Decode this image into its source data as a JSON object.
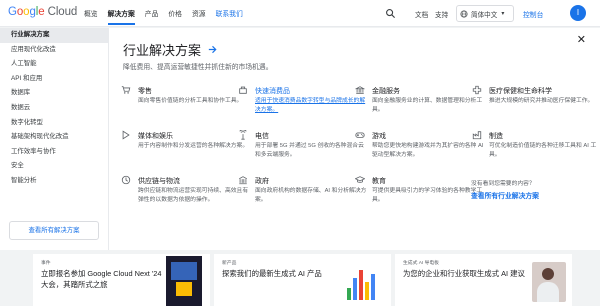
{
  "header": {
    "logo": {
      "g": "G",
      "o1": "o",
      "o2": "o",
      "g2": "g",
      "l": "l",
      "e": "e",
      "cloud": "Cloud"
    },
    "nav": [
      "概览",
      "解决方案",
      "产品",
      "价格",
      "资源",
      "联系我们"
    ],
    "active_nav": "解决方案",
    "docs": "文档",
    "support": "支持",
    "language": "简体中文",
    "console": "控制台",
    "avatar_letter": "I"
  },
  "sidebar": {
    "items": [
      "行业解决方案",
      "应用现代化改造",
      "人工智能",
      "API 和应用",
      "数据库",
      "数据云",
      "数字化转型",
      "基础架构现代化改造",
      "工作效率与协作",
      "安全",
      "智能分析"
    ],
    "active_index": 0,
    "view_all": "查看所有解决方案"
  },
  "panel": {
    "title": "行业解决方案",
    "description": "降低费用、提高运营敏捷性并抓住新的市场机遇。",
    "close_icon": "close-icon",
    "cards": [
      {
        "icon": "cart-icon",
        "title": "零售",
        "desc": "面向零售价值链的分析工具和协作工具。"
      },
      {
        "icon": "cpg-icon",
        "title": "快速消费品",
        "desc": "适用于快速消费品数字转型与品牌成长的解决方案。",
        "highlighted": true
      },
      {
        "icon": "bank-icon",
        "title": "金融服务",
        "desc": "面向金融服务业的计算、数据管理和分析工具。"
      },
      {
        "icon": "health-icon",
        "title": "医疗保健和生命科学",
        "desc": "推进大规模的研究并推动医疗保健工作。"
      },
      {
        "icon": "media-icon",
        "title": "媒体和娱乐",
        "desc": "用于内容制作和分发运营的各种解决方案。"
      },
      {
        "icon": "telecom-icon",
        "title": "电信",
        "desc": "用于部署 5G 并通过 5G 创收的各种混合云和多云端服务。"
      },
      {
        "icon": "game-icon",
        "title": "游戏",
        "desc": "帮助您更快地构建游戏并为其扩容的各种 AI 驱动型解决方案。"
      },
      {
        "icon": "factory-icon",
        "title": "制造",
        "desc": "可优化制造价值链的各种迁移工具和 AI 工具。"
      },
      {
        "icon": "supply-icon",
        "title": "供应链与物流",
        "desc": "跨供应链和物流运营实现可持续、高效且有弹性的以数据为依据的操作。"
      },
      {
        "icon": "gov-icon",
        "title": "政府",
        "desc": "面向政府机构的数据存储、AI 和分析解决方案。"
      },
      {
        "icon": "edu-icon",
        "title": "教育",
        "desc": "可提供更具吸引力的学习体验的各种教学工具。"
      }
    ],
    "ask": "没有看到您需要的内容？",
    "view_all_industries": "查看所有行业解决方案"
  },
  "promos": [
    {
      "tag": "事件",
      "title": "立即报名参加 Google Cloud Next '24",
      "title2": "大会，其踏所式之旅"
    },
    {
      "tag": "新产品",
      "title": "探索我们的最新生成式 AI 产品",
      "title2": ""
    },
    {
      "tag": "生成式 AI 导电板",
      "title": "为您的企业和行业获取生成式 AI 建议",
      "title2": ""
    }
  ]
}
